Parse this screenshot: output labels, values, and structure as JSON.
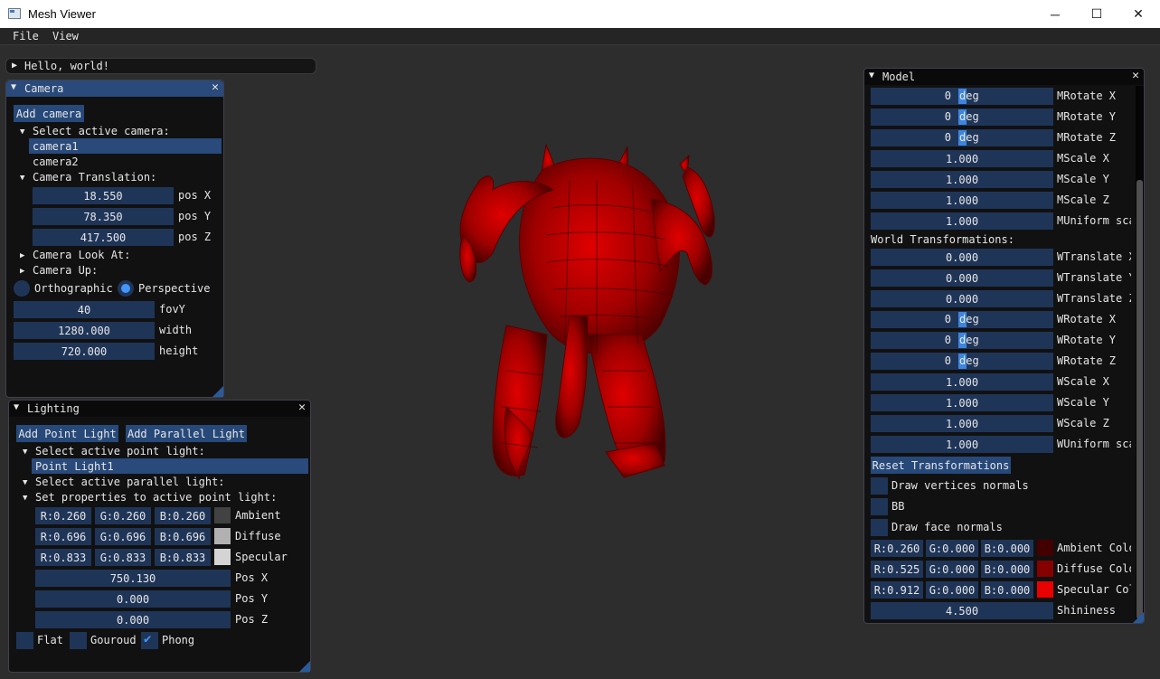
{
  "window": {
    "title": "Mesh Viewer",
    "minimize": "─",
    "maximize": "☐",
    "close": "✕"
  },
  "menu": {
    "file": "File",
    "view": "View"
  },
  "hello": {
    "label": "Hello, world!"
  },
  "camera": {
    "title": "Camera",
    "add_button": "Add camera",
    "select_label": "Select active camera:",
    "cameras": [
      "camera1",
      "camera2"
    ],
    "translation_label": "Camera Translation:",
    "pos_x": "18.550",
    "pos_x_label": "pos X",
    "pos_y": "78.350",
    "pos_y_label": "pos Y",
    "pos_z": "417.500",
    "pos_z_label": "pos Z",
    "look_at_label": "Camera Look At:",
    "up_label": "Camera Up:",
    "ortho_label": "Orthographic",
    "persp_label": "Perspective",
    "fovy": "40",
    "fovy_label": "fovY",
    "width": "1280.000",
    "width_label": "width",
    "height": "720.000",
    "height_label": "height"
  },
  "lighting": {
    "title": "Lighting",
    "add_point": "Add Point Light",
    "add_parallel": "Add Parallel Light",
    "select_point_label": "Select active point light:",
    "point_light": "Point Light1",
    "select_parallel_label": "Select active parallel light:",
    "props_label": "Set properties to active point light:",
    "ambient": {
      "r": "R:0.260",
      "g": "G:0.260",
      "b": "B:0.260",
      "label": "Ambient",
      "color": "#424242"
    },
    "diffuse": {
      "r": "R:0.696",
      "g": "G:0.696",
      "b": "B:0.696",
      "label": "Diffuse",
      "color": "#b1b1b1"
    },
    "specular": {
      "r": "R:0.833",
      "g": "G:0.833",
      "b": "B:0.833",
      "label": "Specular",
      "color": "#d4d4d4"
    },
    "pos_x": "750.130",
    "pos_x_label": "Pos X",
    "pos_y": "0.000",
    "pos_y_label": "Pos Y",
    "pos_z": "0.000",
    "pos_z_label": "Pos Z",
    "flat": "Flat",
    "gouraud": "Gouroud",
    "phong": "Phong"
  },
  "model": {
    "title": "Model",
    "deg": "deg",
    "m_rotate_x": {
      "value": "0",
      "label": "MRotate X"
    },
    "m_rotate_y": {
      "value": "0",
      "label": "MRotate Y"
    },
    "m_rotate_z": {
      "value": "0",
      "label": "MRotate Z"
    },
    "m_scale_x": {
      "value": "1.000",
      "label": "MScale X"
    },
    "m_scale_y": {
      "value": "1.000",
      "label": "MScale Y"
    },
    "m_scale_z": {
      "value": "1.000",
      "label": "MScale Z"
    },
    "m_uniform": {
      "value": "1.000",
      "label": "MUniform sca"
    },
    "world_label": "World Transformations:",
    "w_translate_x": {
      "value": "0.000",
      "label": "WTranslate X"
    },
    "w_translate_y": {
      "value": "0.000",
      "label": "WTranslate Y"
    },
    "w_translate_z": {
      "value": "0.000",
      "label": "WTranslate Z"
    },
    "w_rotate_x": {
      "value": "0",
      "label": "WRotate X"
    },
    "w_rotate_y": {
      "value": "0",
      "label": "WRotate Y"
    },
    "w_rotate_z": {
      "value": "0",
      "label": "WRotate Z"
    },
    "w_scale_x": {
      "value": "1.000",
      "label": "WScale X"
    },
    "w_scale_y": {
      "value": "1.000",
      "label": "WScale Y"
    },
    "w_scale_z": {
      "value": "1.000",
      "label": "WScale Z"
    },
    "w_uniform": {
      "value": "1.000",
      "label": "WUniform sca"
    },
    "reset": "Reset Transformations",
    "draw_vertex_normals": "Draw vertices normals",
    "bb": "BB",
    "draw_face_normals": "Draw face normals",
    "ambient": {
      "r": "R:0.260",
      "g": "G:0.000",
      "b": "B:0.000",
      "label": "Ambient Colo",
      "color": "#420000"
    },
    "diffuse": {
      "r": "R:0.525",
      "g": "G:0.000",
      "b": "B:0.000",
      "label": "Diffuse Colo",
      "color": "#860000"
    },
    "specular": {
      "r": "R:0.912",
      "g": "G:0.000",
      "b": "B:0.000",
      "label": "Specular Col",
      "color": "#e90000"
    },
    "shininess": {
      "value": "4.500",
      "label": "Shininess"
    }
  },
  "colors": {
    "accent": "#294a7a",
    "field": "#1f3558",
    "mesh": "#c80000"
  }
}
